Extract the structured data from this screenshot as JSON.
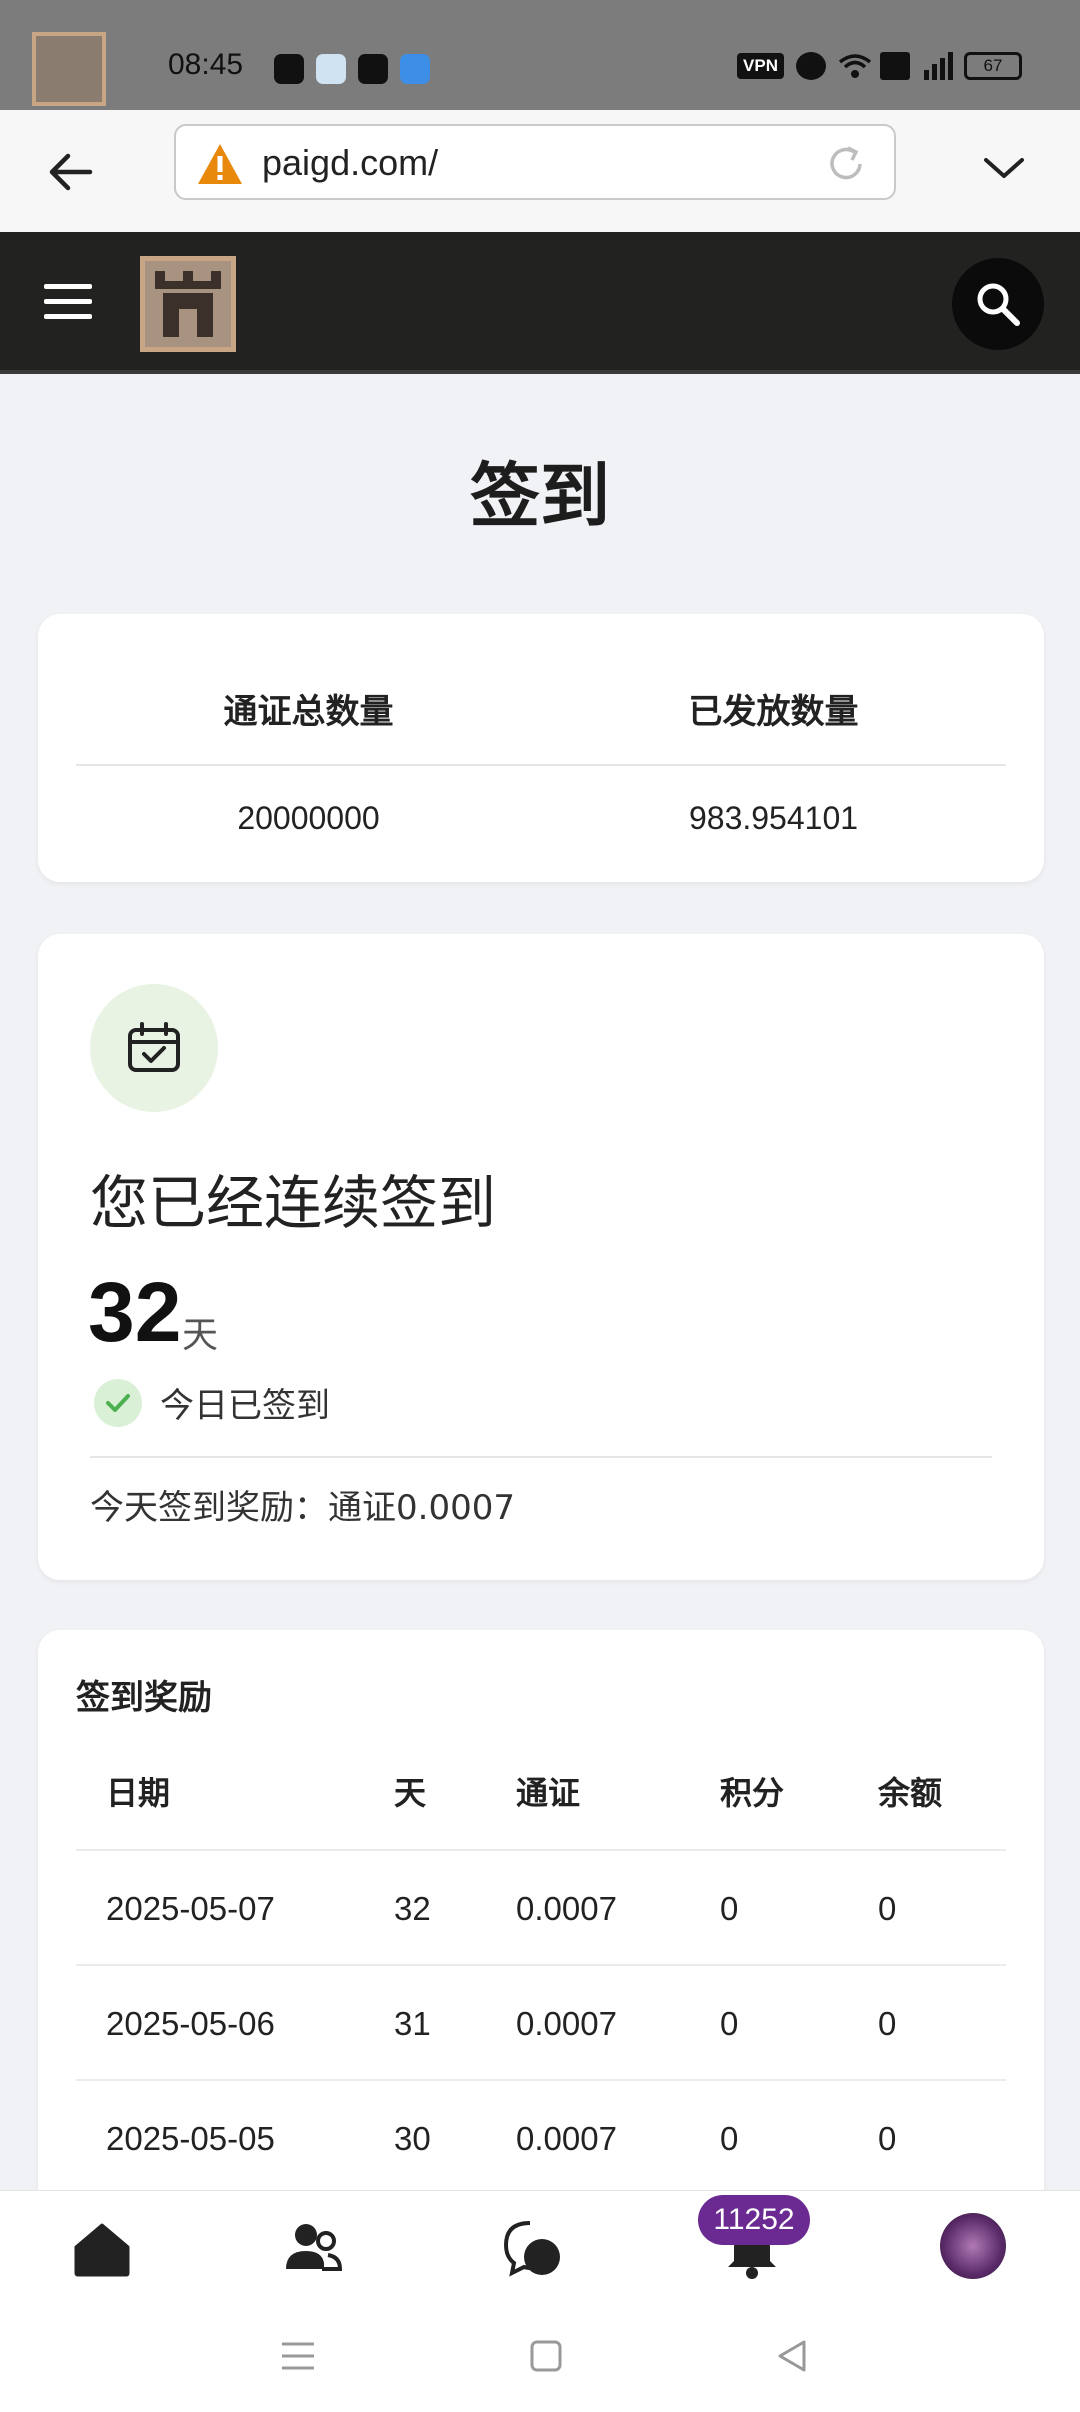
{
  "status_bar": {
    "time": "08:45",
    "vpn_label": "VPN",
    "battery": "67"
  },
  "browser": {
    "url": "paigd.com/"
  },
  "page": {
    "title": "签到"
  },
  "stats": {
    "total_label": "通证总数量",
    "issued_label": "已发放数量",
    "total_value": "20000000",
    "issued_value": "983.954101"
  },
  "checkin": {
    "streak_label": "您已经连续签到",
    "streak_days": "32",
    "unit": "天",
    "signed_status": "今日已签到",
    "today_reward": "今天签到奖励：通证0.0007"
  },
  "rewards": {
    "title": "签到奖励",
    "columns": [
      "日期",
      "天",
      "通证",
      "积分",
      "余额"
    ],
    "rows": [
      [
        "2025-05-07",
        "32",
        "0.0007",
        "0",
        "0"
      ],
      [
        "2025-05-06",
        "31",
        "0.0007",
        "0",
        "0"
      ],
      [
        "2025-05-05",
        "30",
        "0.0007",
        "0",
        "0"
      ]
    ]
  },
  "bottom_nav": {
    "notification_count": "11252"
  },
  "colors": {
    "header_bg": "#222321",
    "logo_gold": "#c8a685",
    "success_green": "#4caf50",
    "badge_purple": "#6b2a91"
  }
}
